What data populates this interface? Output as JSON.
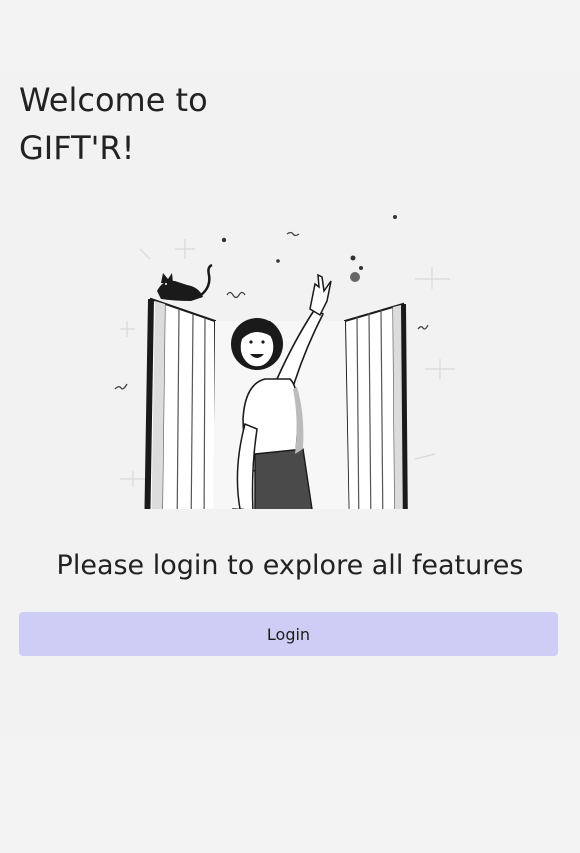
{
  "header": {
    "title": "Welcome to\nGIFT'R!"
  },
  "main": {
    "illustration_icon": "woman-at-window-with-cat-illustration",
    "tagline": "Please login to explore all features",
    "login_label": "Login"
  },
  "colors": {
    "background": "#f2f2f2",
    "button_bg": "#cecdf6",
    "text": "#222222"
  }
}
